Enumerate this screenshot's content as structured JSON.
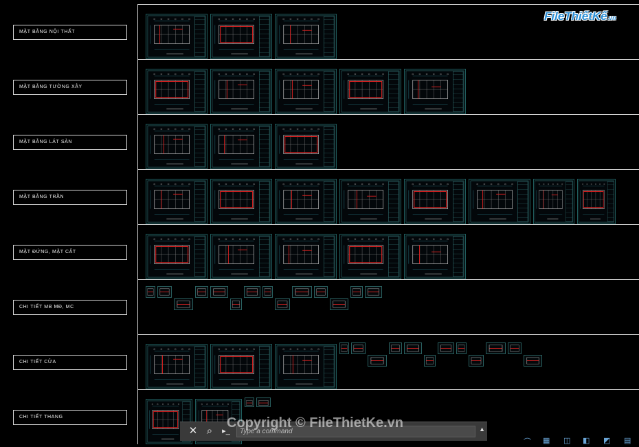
{
  "logo": {
    "brand": "FileThiếtKế",
    "tld": ".vn",
    "colors": {
      "primary": "#2c8fd6",
      "outline": "#ffffff"
    }
  },
  "watermark": "Copyright © FileThietKe.vn",
  "command_line": {
    "placeholder": "Type a command",
    "close_icon": "close-icon",
    "search_icon": "search-icon",
    "prompt_icon": "command-prompt-icon",
    "dropdown_icon": "chevron-up-icon"
  },
  "sections": [
    {
      "label": "MẶT BẰNG NỘI THẤT",
      "sheets": 3,
      "minis": 0
    },
    {
      "label": "MẶT BẰNG TƯỜNG XÂY",
      "sheets": 5,
      "minis": 0
    },
    {
      "label": "MẶT BẰNG LÁT SÀN",
      "sheets": 3,
      "minis": 0
    },
    {
      "label": "MẶT BẰNG TRẦN",
      "sheets": 8,
      "minis": 0
    },
    {
      "label": "MẶT ĐỨNG, MẶT CẮT",
      "sheets": 5,
      "minis": 0
    },
    {
      "label": "CHI TIẾT MB MĐ, MC",
      "sheets": 0,
      "minis": 14
    },
    {
      "label": "CHI TIẾT CỬA",
      "sheets": 3,
      "minis": 12
    },
    {
      "label": "CHI TIẾT THANG",
      "sheets": 2,
      "minis": 2
    }
  ],
  "colors": {
    "background": "#000000",
    "sheet_border": "#1f5c5c",
    "wall_red": "#d02020",
    "line_cyan": "#40c0d0"
  }
}
